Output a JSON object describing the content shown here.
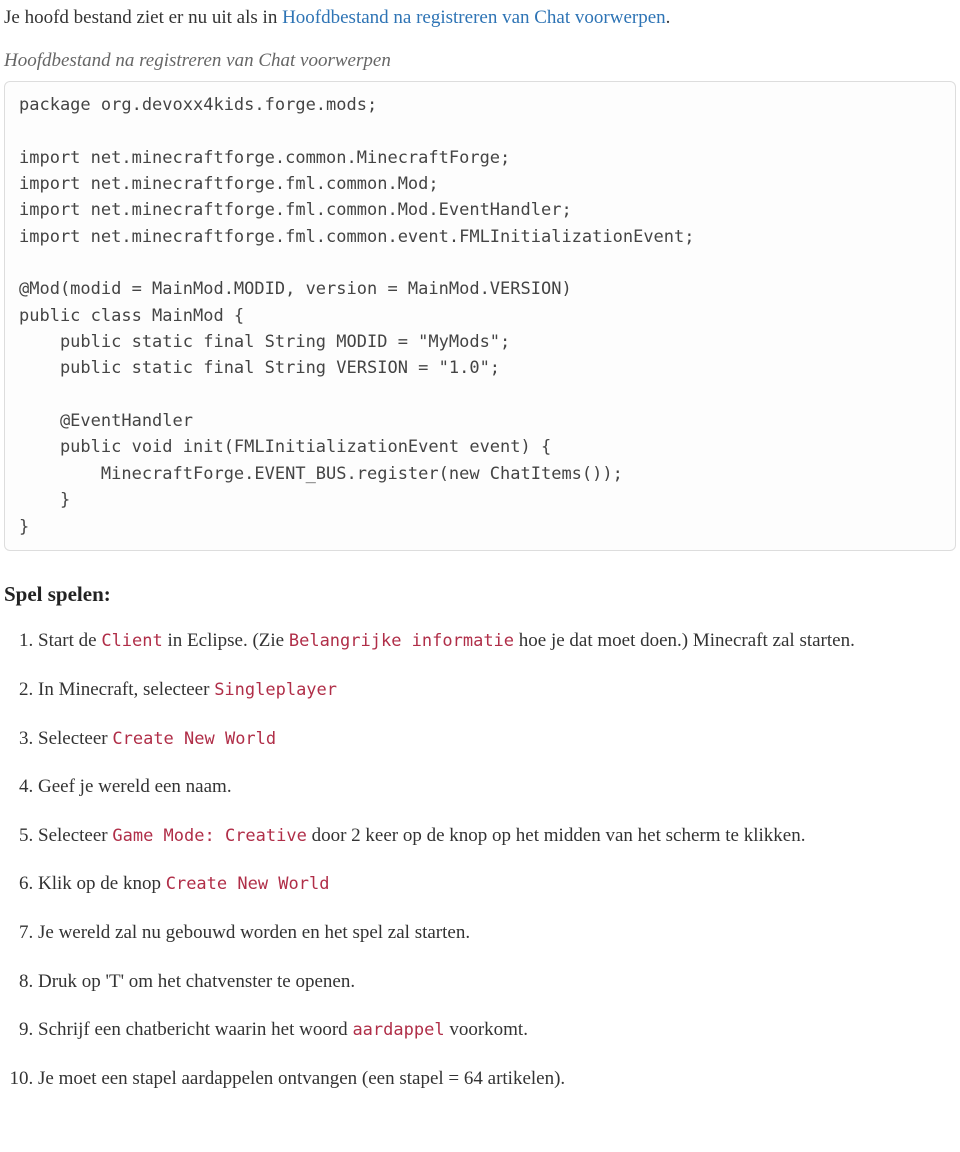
{
  "intro": {
    "prefix": "Je hoofd bestand ziet er nu uit als in ",
    "link": "Hoofdbestand na registreren van Chat voorwerpen",
    "suffix": "."
  },
  "caption": "Hoofdbestand na registreren van Chat voorwerpen",
  "code": "package org.devoxx4kids.forge.mods;\n\nimport net.minecraftforge.common.MinecraftForge;\nimport net.minecraftforge.fml.common.Mod;\nimport net.minecraftforge.fml.common.Mod.EventHandler;\nimport net.minecraftforge.fml.common.event.FMLInitializationEvent;\n\n@Mod(modid = MainMod.MODID, version = MainMod.VERSION)\npublic class MainMod {\n    public static final String MODID = \"MyMods\";\n    public static final String VERSION = \"1.0\";\n\n    @EventHandler\n    public void init(FMLInitializationEvent event) {\n        MinecraftForge.EVENT_BUS.register(new ChatItems());\n    }\n}",
  "heading": "Spel spelen:",
  "steps": [
    {
      "parts": [
        {
          "t": "Start de "
        },
        {
          "t": "Client",
          "code": true
        },
        {
          "t": " in Eclipse. (Zie "
        },
        {
          "t": "Belangrijke informatie",
          "code": true
        },
        {
          "t": " hoe je dat moet doen.) Minecraft zal starten."
        }
      ]
    },
    {
      "parts": [
        {
          "t": "In Minecraft, selecteer "
        },
        {
          "t": "Singleplayer",
          "code": true
        }
      ]
    },
    {
      "parts": [
        {
          "t": "Selecteer "
        },
        {
          "t": "Create New World",
          "code": true
        }
      ]
    },
    {
      "parts": [
        {
          "t": "Geef je wereld een naam."
        }
      ]
    },
    {
      "parts": [
        {
          "t": "Selecteer "
        },
        {
          "t": "Game Mode: Creative",
          "code": true
        },
        {
          "t": " door 2 keer op de knop op het midden van het scherm te klikken."
        }
      ]
    },
    {
      "parts": [
        {
          "t": "Klik op de knop "
        },
        {
          "t": "Create New World",
          "code": true
        }
      ]
    },
    {
      "parts": [
        {
          "t": "Je wereld zal nu gebouwd worden en het spel zal starten."
        }
      ]
    },
    {
      "parts": [
        {
          "t": "Druk op 'T' om het chatvenster te openen."
        }
      ]
    },
    {
      "parts": [
        {
          "t": "Schrijf een chatbericht waarin het woord "
        },
        {
          "t": "aardappel",
          "code": true
        },
        {
          "t": " voorkomt."
        }
      ]
    },
    {
      "parts": [
        {
          "t": "Je moet een stapel aardappelen ontvangen (een stapel = 64 artikelen)."
        }
      ]
    }
  ]
}
